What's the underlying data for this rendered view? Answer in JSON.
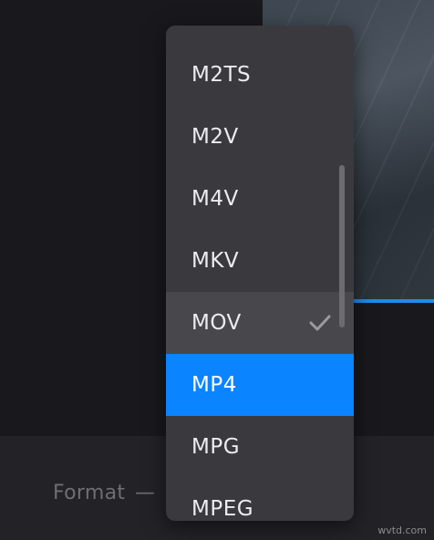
{
  "format_field": {
    "label": "Format",
    "dash": "—"
  },
  "format_menu": {
    "items": [
      {
        "label": "M2TS"
      },
      {
        "label": "M2V"
      },
      {
        "label": "M4V"
      },
      {
        "label": "MKV"
      },
      {
        "label": "MOV",
        "checked": true
      },
      {
        "label": "MP4",
        "highlighted": true
      },
      {
        "label": "MPG"
      },
      {
        "label": "MPEG"
      }
    ]
  },
  "watermark": "wvtd.com",
  "colors": {
    "highlight": "#0a84ff",
    "menu_background": "#3a3a3e",
    "app_background": "#19191d",
    "accent_bar": "#1c8cf0"
  },
  "icons": {
    "checked_item": "checkmark-icon"
  }
}
